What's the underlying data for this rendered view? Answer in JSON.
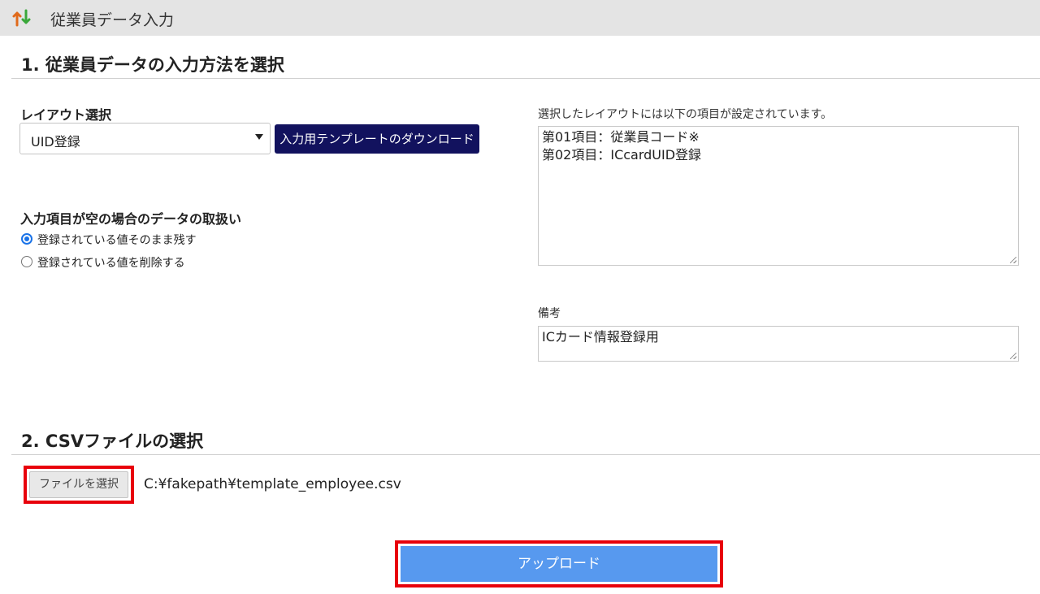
{
  "window": {
    "title": "従業員データ入力",
    "icon": "sort-arrows-icon"
  },
  "section1": {
    "title": "1. 従業員データの入力方法を選択",
    "layout_label": "レイアウト選択",
    "layout_select_value": "UID登録",
    "template_download_label": "入力用テンプレートのダウンロード",
    "empty_handling_label": "入力項目が空の場合のデータの取扱い",
    "radio_options": [
      {
        "label": "登録されている値そのまま残す",
        "checked": true
      },
      {
        "label": "登録されている値を削除する",
        "checked": false
      }
    ],
    "fields_description": "選択したレイアウトには以下の項目が設定されています。",
    "fields_list": [
      "第01項目：従業員コード※",
      "第02項目：ICcardUID登録"
    ],
    "remarks_label": "備考",
    "remarks_value": "ICカード情報登録用"
  },
  "section2": {
    "title": "2. CSVファイルの選択",
    "choose_file_label": "ファイルを選択",
    "file_path": "C:¥fakepath¥template_employee.csv"
  },
  "upload_label": "アップロード",
  "colors": {
    "titlebar_bg": "#e4e4e4",
    "download_button_bg": "#12125e",
    "upload_button_bg": "#5799ef",
    "highlight_border": "#e8000b",
    "radio_accent": "#1a73e8"
  }
}
